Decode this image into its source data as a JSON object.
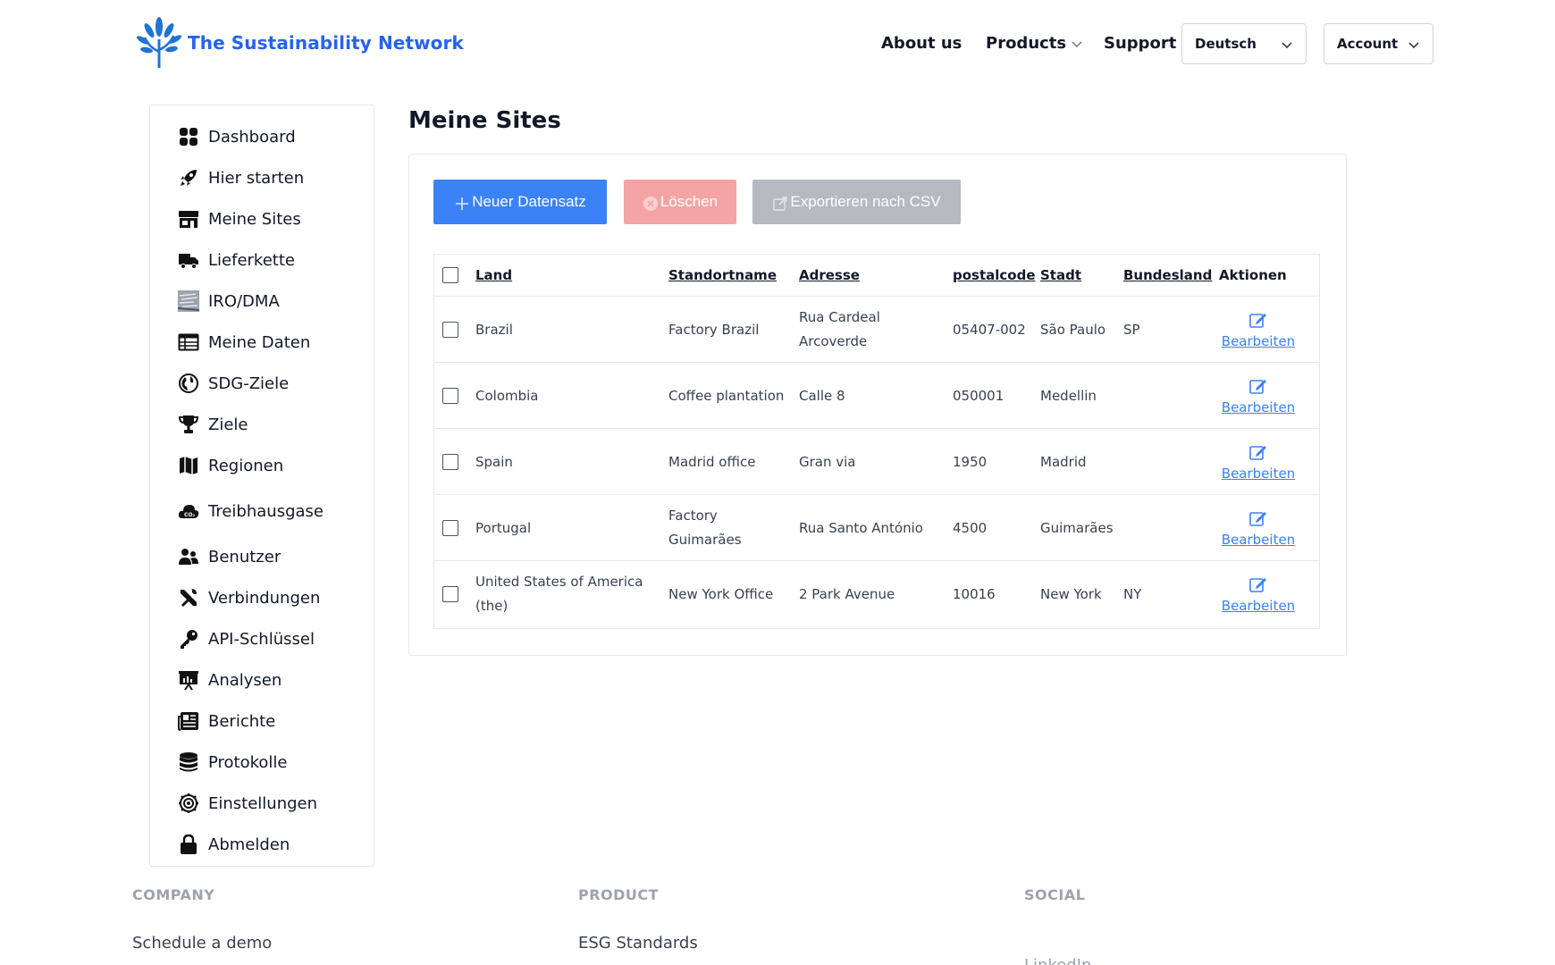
{
  "header": {
    "brand": "The Sustainability Network",
    "nav": {
      "about": "About us",
      "products": "Products",
      "support": "Support"
    },
    "language": "Deutsch",
    "account": "Account"
  },
  "sidebar": {
    "items": [
      {
        "label": "Dashboard",
        "icon": "dashboard-icon"
      },
      {
        "label": "Hier starten",
        "icon": "rocket-icon"
      },
      {
        "label": "Meine Sites",
        "icon": "store-icon"
      },
      {
        "label": "Lieferkette",
        "icon": "truck-icon"
      },
      {
        "label": "IRO/DMA",
        "icon": "iro-image-icon"
      },
      {
        "label": "Meine Daten",
        "icon": "table-icon"
      },
      {
        "label": "SDG-Ziele",
        "icon": "globe-icon"
      },
      {
        "label": "Ziele",
        "icon": "trophy-icon"
      },
      {
        "label": "Regionen",
        "icon": "map-icon"
      },
      {
        "label": "Treibhausgase",
        "icon": "co2-cloud-icon"
      },
      {
        "label": "Benutzer",
        "icon": "users-icon"
      },
      {
        "label": "Verbindungen",
        "icon": "tools-icon"
      },
      {
        "label": "API-Schlüssel",
        "icon": "key-icon"
      },
      {
        "label": "Analysen",
        "icon": "chart-board-icon"
      },
      {
        "label": "Berichte",
        "icon": "newspaper-icon"
      },
      {
        "label": "Protokolle",
        "icon": "database-icon"
      },
      {
        "label": "Einstellungen",
        "icon": "gear-icon"
      },
      {
        "label": "Abmelden",
        "icon": "lock-icon"
      }
    ]
  },
  "main": {
    "title": "Meine Sites",
    "toolbar": {
      "new": "Neuer Datensatz",
      "delete": "Löschen",
      "export": "Exportieren nach CSV"
    },
    "table": {
      "headers": {
        "land": "Land",
        "standortname": "Standortname",
        "adresse": "Adresse",
        "postalcode": "postalcode",
        "stadt": "Stadt",
        "bundesland": "Bundesland",
        "aktionen": "Aktionen"
      },
      "edit_label": "Bearbeiten",
      "rows": [
        {
          "land": "Brazil",
          "standortname": "Factory Brazil",
          "adresse": "Rua Cardeal Arcoverde",
          "postalcode": "05407-002",
          "stadt": "São Paulo",
          "bundesland": "SP"
        },
        {
          "land": "Colombia",
          "standortname": "Coffee plantation",
          "adresse": "Calle 8",
          "postalcode": "050001",
          "stadt": "Medellin",
          "bundesland": ""
        },
        {
          "land": "Spain",
          "standortname": "Madrid office",
          "adresse": "Gran via",
          "postalcode": "1950",
          "stadt": "Madrid",
          "bundesland": ""
        },
        {
          "land": "Portugal",
          "standortname": "Factory Guimarães",
          "adresse": "Rua Santo António",
          "postalcode": "4500",
          "stadt": "Guimarães",
          "bundesland": ""
        },
        {
          "land": "United States of America (the)",
          "standortname": "New York Office",
          "adresse": "2 Park Avenue",
          "postalcode": "10016",
          "stadt": "New York",
          "bundesland": "NY"
        }
      ]
    }
  },
  "footer": {
    "company_heading": "COMPANY",
    "product_heading": "PRODUCT",
    "social_heading": "SOCIAL",
    "company_link": "Schedule a demo",
    "product_link": "ESG Standards",
    "social_link": "LinkedIn"
  },
  "colors": {
    "brand": "#2563eb",
    "primary_button": "#3b82f6",
    "delete_button": "#f4a4a4",
    "export_button": "#b6b9bf",
    "link": "#3b82f6",
    "logo_leaf": "#1d74d3"
  }
}
